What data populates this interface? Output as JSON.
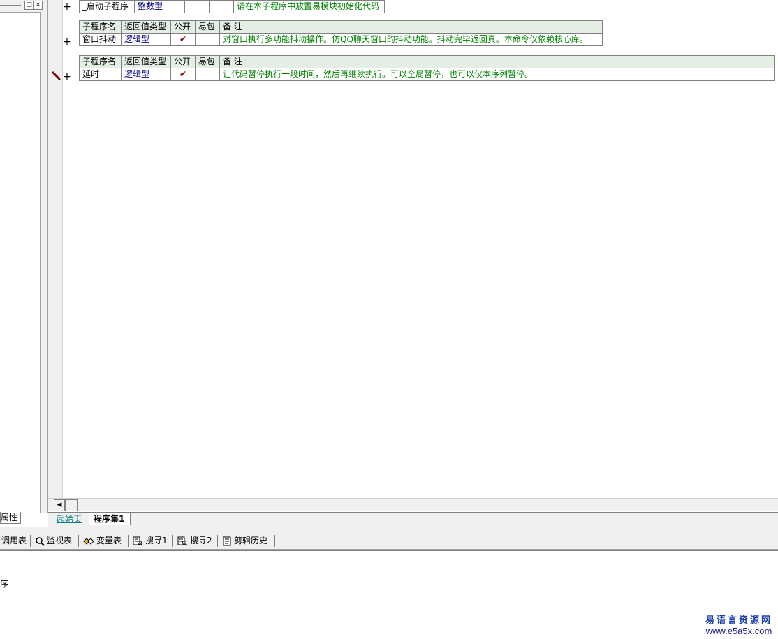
{
  "left_panel": {
    "props_tab_label": "属性"
  },
  "procedures": {
    "startup_row": {
      "name": "_启动子程序",
      "return_type": "整数型",
      "remark": "请在本子程序中放置易模块初始化代码"
    },
    "header": {
      "col_name": "子程序名",
      "col_return_type": "返回值类型",
      "col_public": "公开",
      "col_package": "易包",
      "col_remark": "备 注"
    },
    "window_shake": {
      "name": "窗口抖动",
      "return_type": "逻辑型",
      "public_mark": "✔",
      "remark": "对窗口执行多功能抖动操作。仿QQ聊天窗口的抖动功能。抖动完毕返回真。本命令仅依赖核心库。"
    },
    "delay": {
      "name": "延时",
      "return_type": "逻辑型",
      "public_mark": "✔",
      "remark": "让代码暂停执行一段时间，然后再继续执行。可以全局暂停，也可以仅本序列暂停。"
    }
  },
  "tabs": {
    "start_page": "起始页",
    "active": "程序集1"
  },
  "toolbar": {
    "call_table": "调用表",
    "watch_table": "监视表",
    "variable_table": "变量表",
    "search1": "搜寻1",
    "search2": "搜寻2",
    "clip_history": "剪辑历史"
  },
  "output": {
    "text": "序"
  },
  "watermark": {
    "line1": "易语言资源网",
    "line2": "www.e5a5x.com"
  },
  "colors": {
    "header_bg": "#e4eee4",
    "type_color": "#000080",
    "remark_color": "#008000",
    "check_color": "#8b0000"
  }
}
